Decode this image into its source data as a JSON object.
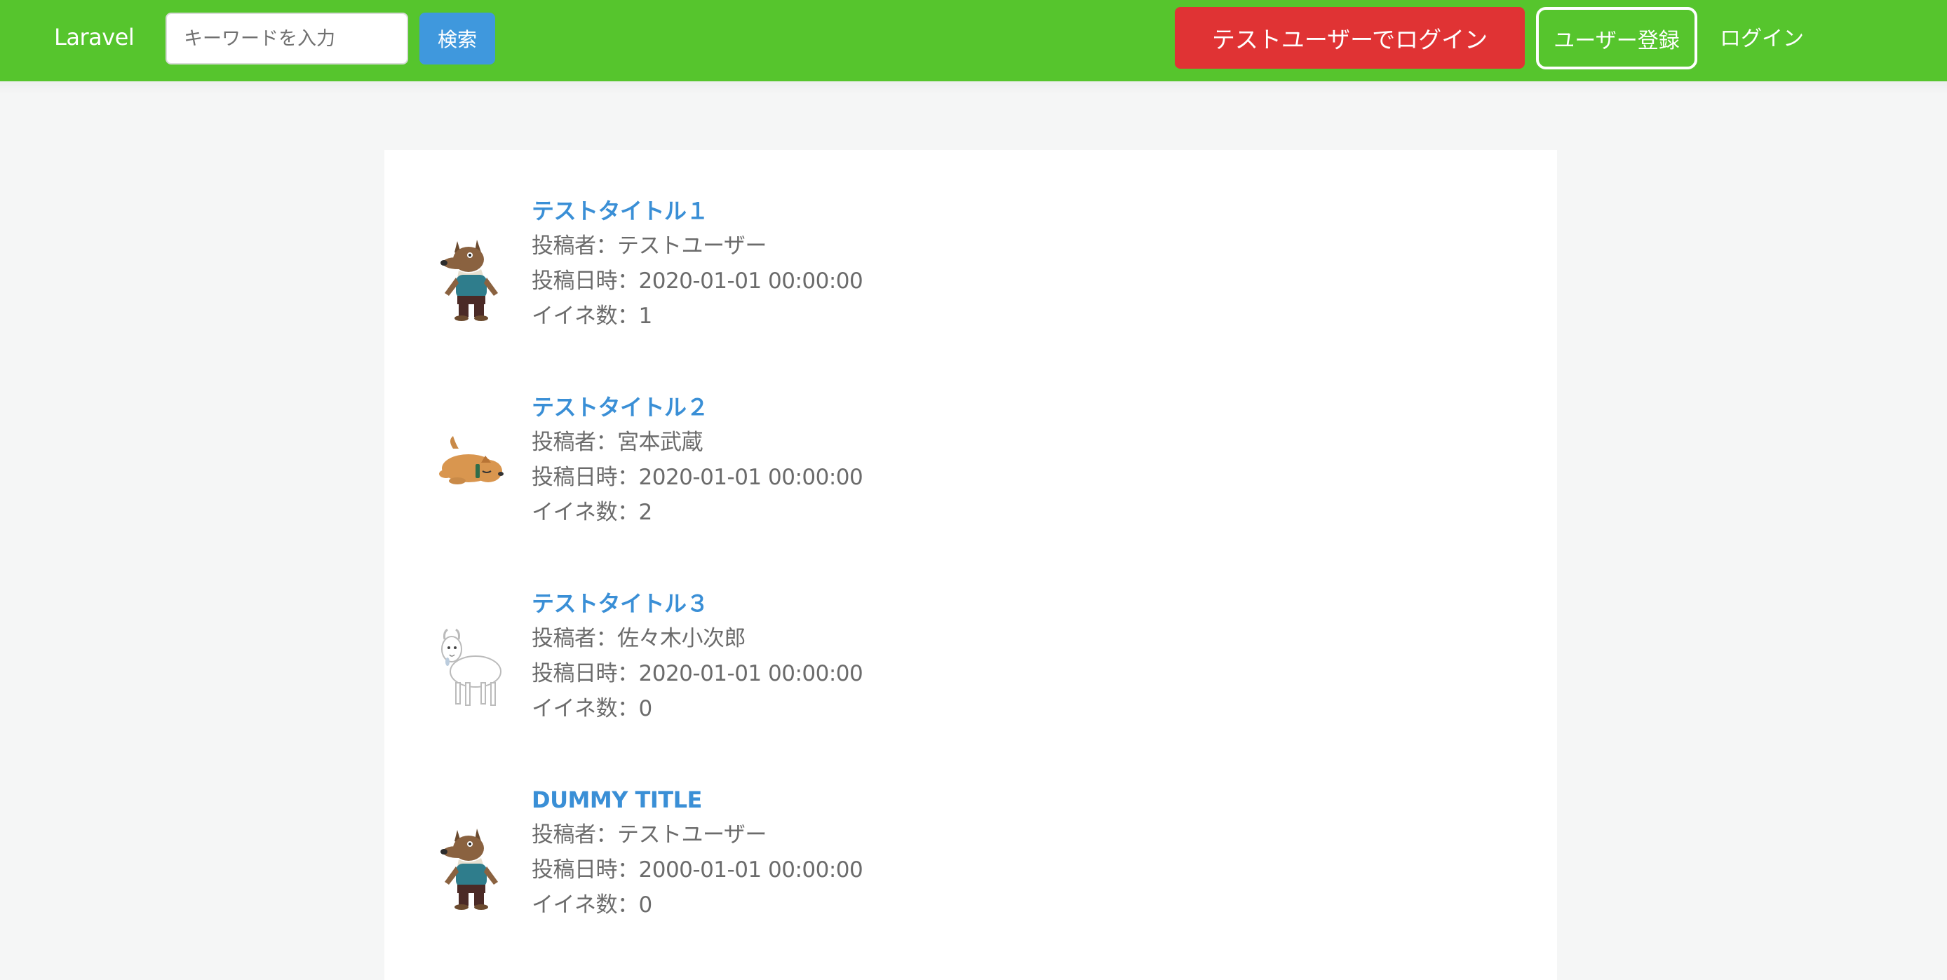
{
  "navbar": {
    "brand": "Laravel",
    "search_placeholder": "キーワードを入力",
    "search_button": "検索",
    "test_login_button": "テストユーザーでログイン",
    "register_button": "ユーザー登録",
    "login_link": "ログイン",
    "background_color": "#56c52d"
  },
  "posts": [
    {
      "title": "テストタイトル１",
      "author": "投稿者：テストユーザー",
      "date": "投稿日時：2020-01-01 00:00:00",
      "likes": "イイネ数：1",
      "avatar_icon": "wolf-icon"
    },
    {
      "title": "テストタイトル２",
      "author": "投稿者：宮本武蔵",
      "date": "投稿日時：2020-01-01 00:00:00",
      "likes": "イイネ数：2",
      "avatar_icon": "sleeping-dog-icon"
    },
    {
      "title": "テストタイトル３",
      "author": "投稿者：佐々木小次郎",
      "date": "投稿日時：2020-01-01 00:00:00",
      "likes": "イイネ数：0",
      "avatar_icon": "goat-icon"
    },
    {
      "title": "DUMMY TITLE",
      "author": "投稿者：テストユーザー",
      "date": "投稿日時：2000-01-01 00:00:00",
      "likes": "イイネ数：0",
      "avatar_icon": "wolf-icon"
    }
  ]
}
